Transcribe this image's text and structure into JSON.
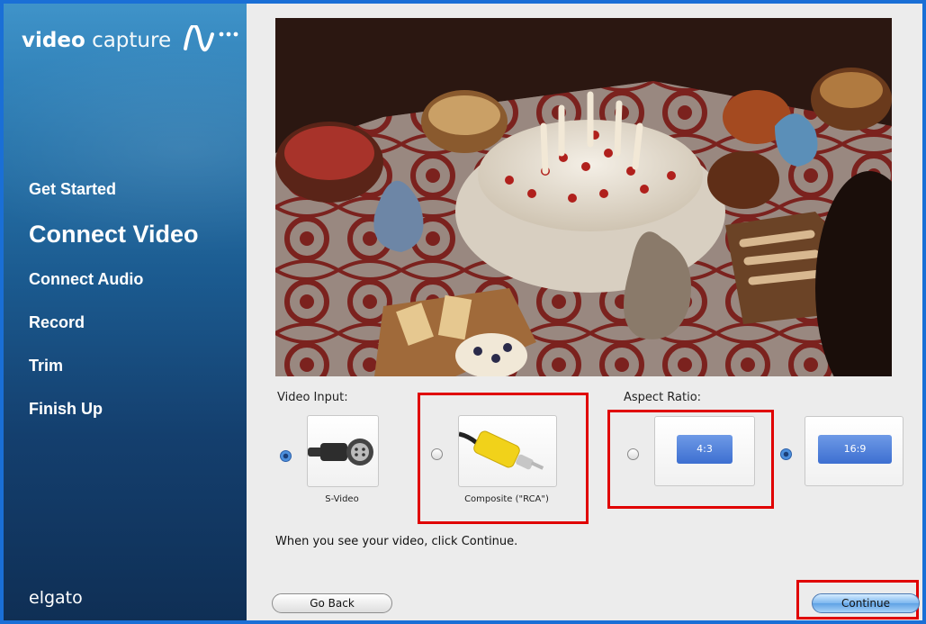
{
  "sidebar": {
    "brand_bold": "video",
    "brand_light": "capture",
    "logo_icon": "wave-signal-icon",
    "items": [
      {
        "label": "Get Started",
        "active": false
      },
      {
        "label": "Connect Video",
        "active": true
      },
      {
        "label": "Connect Audio",
        "active": false
      },
      {
        "label": "Record",
        "active": false
      },
      {
        "label": "Trim",
        "active": false
      },
      {
        "label": "Finish Up",
        "active": false
      }
    ],
    "vendor": "elgato"
  },
  "video_input": {
    "label": "Video Input:",
    "options": [
      {
        "label": "S-Video",
        "selected": true,
        "icon": "s-video-connector-icon"
      },
      {
        "label": "Composite (\"RCA\")",
        "selected": false,
        "icon": "rca-connector-icon"
      }
    ]
  },
  "aspect_ratio": {
    "label": "Aspect Ratio:",
    "options": [
      {
        "label": "4:3",
        "selected": false
      },
      {
        "label": "16:9",
        "selected": true
      }
    ]
  },
  "hint": "When you see your video, click Continue.",
  "buttons": {
    "back": "Go Back",
    "continue": "Continue"
  },
  "colors": {
    "highlight": "#e00000",
    "accent": "#3d6fd1",
    "sidebar": "#1b5a8f"
  }
}
